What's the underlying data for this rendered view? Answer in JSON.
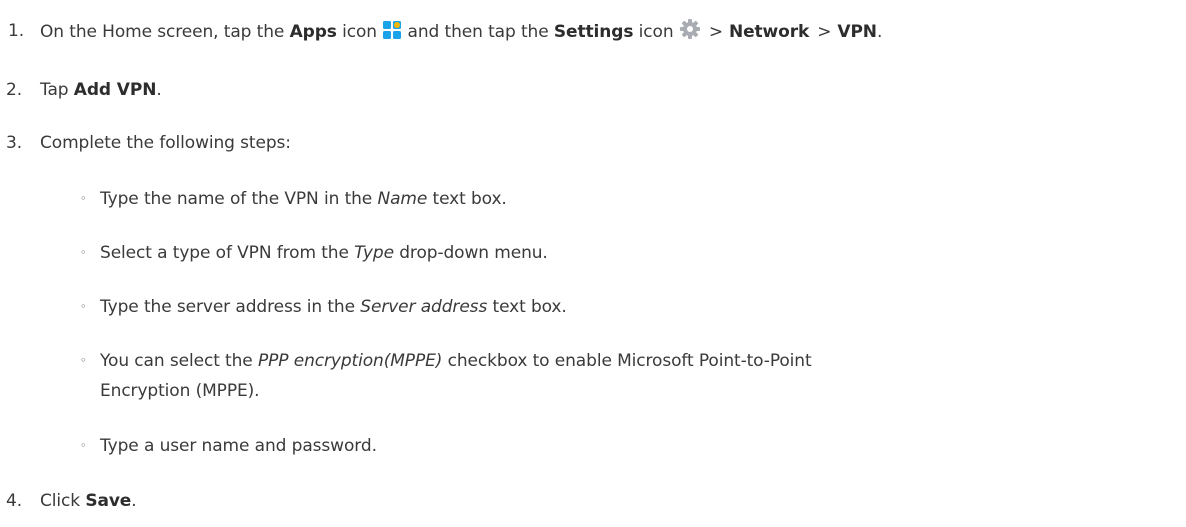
{
  "steps": {
    "s1": {
      "num": "1.",
      "t1": "On the Home screen, tap the ",
      "apps": "Apps",
      "t2": " icon ",
      "t3": " and then tap the ",
      "settings": "Settings",
      "t4": " icon ",
      "sep": ">",
      "network": "Network",
      "vpn": "VPN",
      "end": "."
    },
    "s2": {
      "num": "2.",
      "t1": "Tap ",
      "b": "Add VPN",
      "end": "."
    },
    "s3": {
      "num": "3.",
      "t1": "Complete the following steps:"
    },
    "s4": {
      "num": "4.",
      "t1": "Click ",
      "b": "Save",
      "end": "."
    }
  },
  "substeps": {
    "bullet": "◦",
    "a": {
      "t1": "Type the name of the VPN in the ",
      "i": "Name",
      "t2": " text box."
    },
    "b": {
      "t1": "Select a type of VPN from the ",
      "i": "Type",
      "t2": " drop-down menu."
    },
    "c": {
      "t1": "Type the server address in the ",
      "i": "Server address",
      "t2": " text box."
    },
    "d": {
      "t1": "You can select the ",
      "i": "PPP encryption(MPPE)",
      "t2": " checkbox to enable Microsoft Point-to-Point",
      "t3": "Encryption (MPPE)."
    },
    "e": {
      "t1": "Type a user name and password."
    }
  },
  "icons": {
    "apps": "apps-grid-icon",
    "settings": "settings-gear-icon",
    "apps_color": "#1aa3e8",
    "apps_accent": "#f2b705",
    "settings_color": "#a9adb3"
  }
}
